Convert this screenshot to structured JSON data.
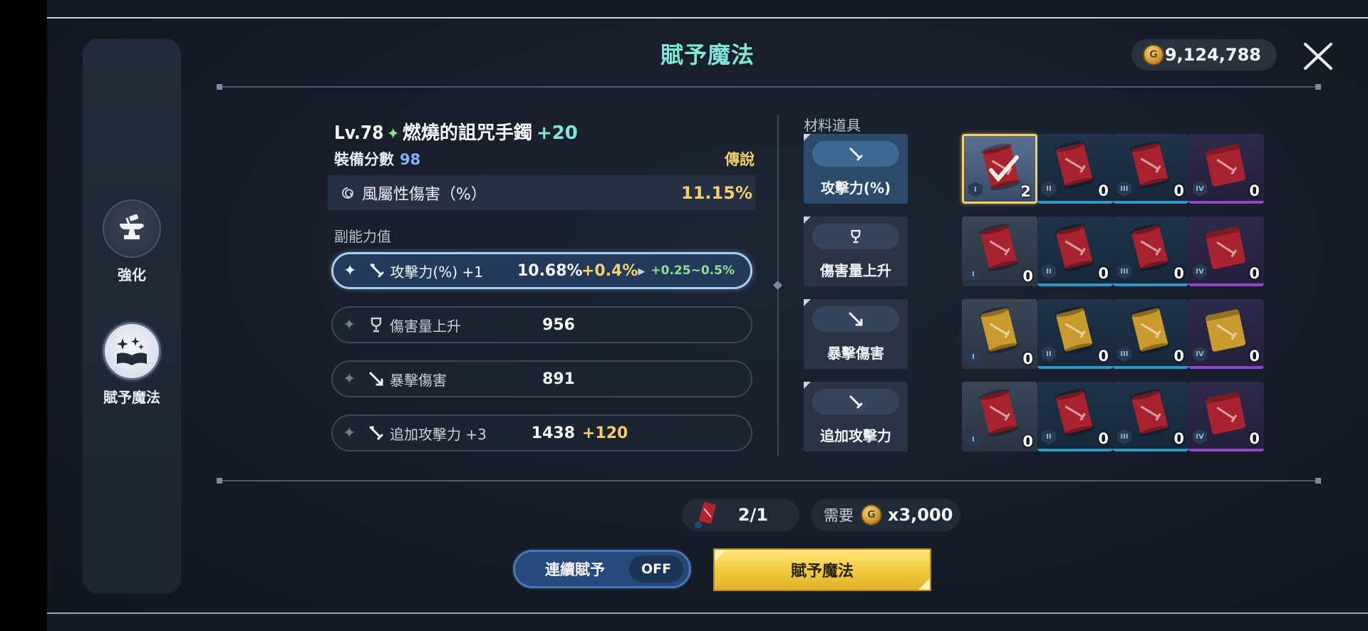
{
  "header": {
    "title": "賦予魔法",
    "gold_amount": "9,124,788"
  },
  "sidebar": {
    "items": [
      {
        "label": "強化",
        "icon": "anvil-icon",
        "active": false
      },
      {
        "label": "賦予魔法",
        "icon": "spellbook-icon",
        "active": true
      }
    ]
  },
  "item": {
    "level": "Lv.78",
    "name": "燃燒的詛咒手鐲",
    "upgrade": "+20",
    "score_label": "裝備分數",
    "score": "98",
    "rarity": "傳說",
    "main_stat": {
      "name": "風屬性傷害（%）",
      "value": "11.15%"
    }
  },
  "substats": {
    "title": "副能力值",
    "rows": [
      {
        "name": "攻擊力(%) +1",
        "value": "10.68%",
        "add": "+0.4%",
        "range": "+0.25~0.5%",
        "icon": "sword-icon",
        "selected": true
      },
      {
        "name": "傷害量上升",
        "value": "956",
        "add": "",
        "range": "",
        "icon": "trophy-icon",
        "selected": false
      },
      {
        "name": "暴擊傷害",
        "value": "891",
        "add": "",
        "range": "",
        "icon": "crit-sword-icon",
        "selected": false
      },
      {
        "name": "追加攻擊力 +3",
        "value": "1438",
        "add": "+120",
        "range": "",
        "icon": "sword-icon",
        "selected": false
      }
    ]
  },
  "materials": {
    "title": "材料道具",
    "rows": [
      {
        "stat": "攻擊力(%)",
        "icon": "sword-icon",
        "selected": true,
        "color": "#a8232f",
        "slots": [
          {
            "tier": "I",
            "count": "2",
            "highlight": true
          },
          {
            "tier": "II",
            "count": "0"
          },
          {
            "tier": "III",
            "count": "0"
          },
          {
            "tier": "IV",
            "count": "0"
          }
        ]
      },
      {
        "stat": "傷害量上升",
        "icon": "trophy-icon",
        "selected": false,
        "color": "#a8232f",
        "slots": [
          {
            "tier": "I",
            "count": "0"
          },
          {
            "tier": "II",
            "count": "0"
          },
          {
            "tier": "III",
            "count": "0"
          },
          {
            "tier": "IV",
            "count": "0"
          }
        ]
      },
      {
        "stat": "暴擊傷害",
        "icon": "crit-sword-icon",
        "selected": false,
        "color": "#c99a2e",
        "slots": [
          {
            "tier": "I",
            "count": "0"
          },
          {
            "tier": "II",
            "count": "0"
          },
          {
            "tier": "III",
            "count": "0"
          },
          {
            "tier": "IV",
            "count": "0"
          }
        ]
      },
      {
        "stat": "追加攻擊力",
        "icon": "sword-icon",
        "selected": false,
        "color": "#a8232f",
        "slots": [
          {
            "tier": "I",
            "count": "0"
          },
          {
            "tier": "II",
            "count": "0"
          },
          {
            "tier": "III",
            "count": "0"
          },
          {
            "tier": "IV",
            "count": "0"
          }
        ]
      }
    ]
  },
  "requirements": {
    "scroll_count": "2/1",
    "cost_label": "需要",
    "cost_amount": "x3,000"
  },
  "actions": {
    "auto_label": "連續賦予",
    "auto_state": "OFF",
    "enchant_label": "賦予魔法"
  },
  "colors": {
    "accent_title": "#7fe6d8",
    "gold_text": "#f2cf6a",
    "range_green": "#8fe08a",
    "score_blue": "#7fb2ff"
  }
}
